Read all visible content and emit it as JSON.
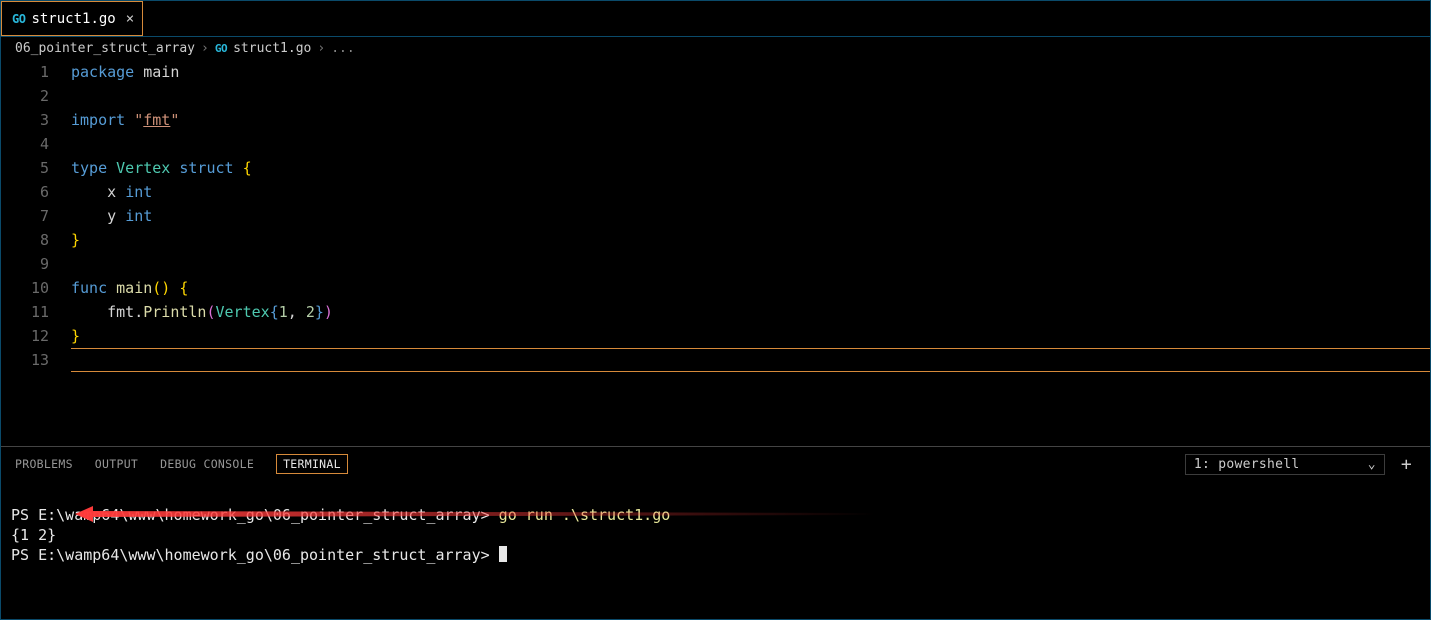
{
  "tab": {
    "icon_label": "GO",
    "filename": "struct1.go"
  },
  "breadcrumb": {
    "folder": "06_pointer_struct_array",
    "icon_label": "GO",
    "file": "struct1.go",
    "rest": "..."
  },
  "editor": {
    "line_numbers": [
      "1",
      "2",
      "3",
      "4",
      "5",
      "6",
      "7",
      "8",
      "9",
      "10",
      "11",
      "12",
      "13"
    ],
    "code": {
      "l1_kw": "package",
      "l1_id": "main",
      "l3_kw": "import",
      "l3_str": "\"",
      "l3_imp": "fmt",
      "l3_str2": "\"",
      "l5_kw": "type",
      "l5_name": "Vertex",
      "l5_kw2": "struct",
      "l5_ob": "{",
      "l6_field": "x",
      "l6_type": "int",
      "l7_field": "y",
      "l7_type": "int",
      "l8_cb": "}",
      "l10_kw": "func",
      "l10_name": "main",
      "l10_p": "()",
      "l10_ob": "{",
      "l11_pkg": "fmt",
      "l11_dot": ".",
      "l11_fn": "Println",
      "l11_op": "(",
      "l11_t": "Vertex",
      "l11_ob": "{",
      "l11_n1": "1",
      "l11_c": ", ",
      "l11_n2": "2",
      "l11_cb": "}",
      "l11_cp": ")",
      "l12_cb": "}"
    }
  },
  "panel": {
    "tabs": {
      "problems": "PROBLEMS",
      "output": "OUTPUT",
      "debug": "DEBUG CONSOLE",
      "terminal": "TERMINAL"
    },
    "select": "1: powershell"
  },
  "terminal": {
    "prompt1_path": "PS E:\\wamp64\\www\\homework_go\\06_pointer_struct_array>",
    "cmd": "go run .\\struct1.go",
    "output": "{1 2}",
    "prompt2_path": "PS E:\\wamp64\\www\\homework_go\\06_pointer_struct_array>"
  }
}
